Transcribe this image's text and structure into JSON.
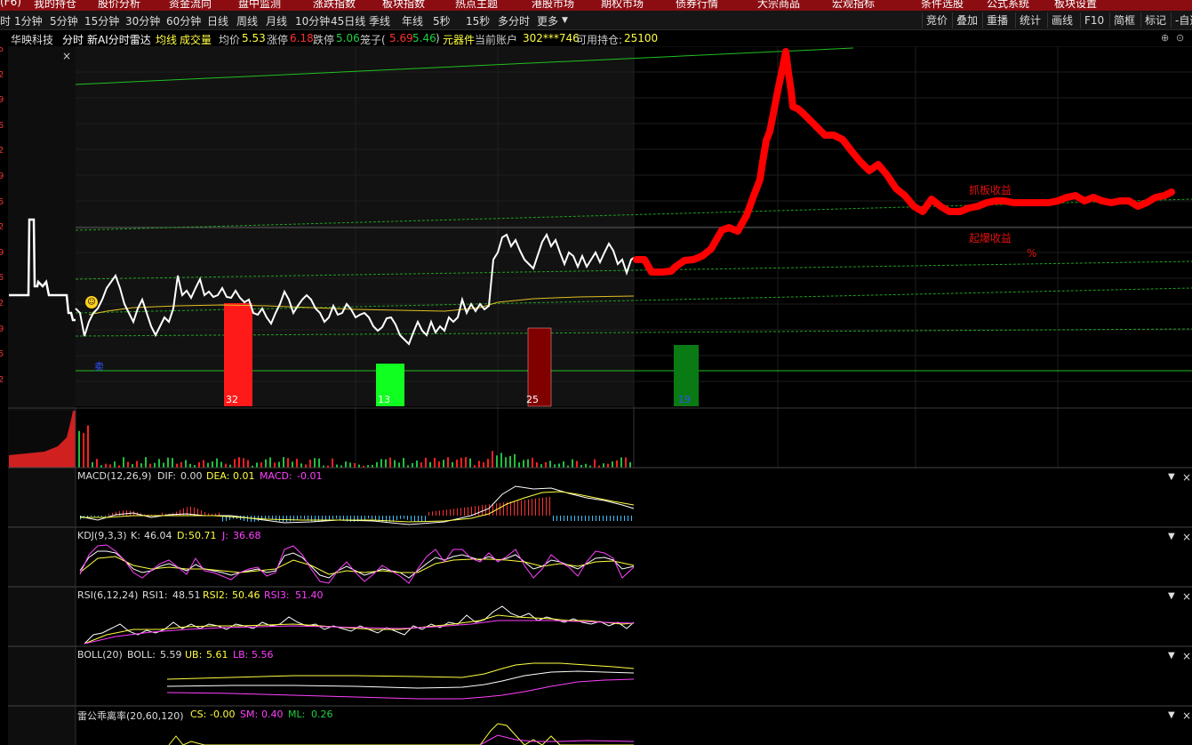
{
  "topbar": {
    "items": [
      "(F6)",
      "我的持仓",
      "股价分析",
      "资金流向",
      "盘中监测",
      "涨跌指数",
      "板块指数",
      "热点主题",
      "港股市场",
      "期权市场",
      "债券行情",
      "大宗商品",
      "宏观指标",
      "条件选股",
      "公式系统",
      "板块设置"
    ]
  },
  "period_tabs": [
    "时",
    "1分钟",
    "5分钟",
    "15分钟",
    "30分钟",
    "60分钟",
    "日线",
    "周线",
    "月线",
    "10分钟",
    "45日线",
    "季线",
    "年线",
    "5秒",
    "15秒",
    "多分时",
    "更多"
  ],
  "right_tools": [
    "竞价",
    "叠加",
    "重播",
    "统计",
    "画线",
    "F10",
    "简框",
    "标记",
    "-自选"
  ],
  "info": {
    "stock_name": "华映科技",
    "mode": "分时",
    "indicator": "新AI分时雷达",
    "avg_line": "均线",
    "volume": "成交量",
    "avg_price_label": "均价",
    "avg_price": "5.53",
    "limit_up_label": "涨停",
    "limit_up": "6.18",
    "limit_down_label": "跌停",
    "limit_down": "5.06",
    "cage_label": "笼子(",
    "cage_low": "5.69",
    "cage_high": "5.46",
    "cage_close": ")",
    "widget": "元器件",
    "account_label": "当前账户",
    "account": "302***746",
    "holding_label": "可用持仓:",
    "holding": "25100"
  },
  "left_axis_ticks": [
    "5",
    "2",
    "9",
    "5",
    "2",
    "9",
    "5",
    "2",
    "9",
    "5",
    "2",
    "9",
    "5",
    "2"
  ],
  "main_chart": {
    "icon_label": "卖",
    "bar_labels": [
      "32",
      "13",
      "25",
      "19"
    ],
    "annotation_1": "抓板收益",
    "annotation_2": "起爆收益",
    "annotation_3": "%"
  },
  "panels": {
    "macd": {
      "name": "MACD(12,26,9)",
      "dif_label": "DIF:",
      "dif": "0.00",
      "dea_label": "DEA:",
      "dea": "0.01",
      "macd_label": "MACD:",
      "macd": "-0.01"
    },
    "kdj": {
      "name": "KDJ(9,3,3)",
      "k_label": "K:",
      "k": "46.04",
      "d_label": "D:",
      "d": "50.71",
      "j_label": "J:",
      "j": "36.68"
    },
    "rsi": {
      "name": "RSI(6,12,24)",
      "rsi1_label": "RSI1:",
      "rsi1": "48.51",
      "rsi2_label": "RSI2:",
      "rsi2": "50.46",
      "rsi3_label": "RSI3:",
      "rsi3": "51.40"
    },
    "boll": {
      "name": "BOLL(20)",
      "boll_label": "BOLL:",
      "boll": "5.59",
      "ub_label": "UB:",
      "ub": "5.61",
      "lb_label": "LB:",
      "lb": "5.56"
    },
    "lgqll": {
      "name": "雷公乖离率(20,60,120)",
      "cs_label": "CS:",
      "cs": "-0.00",
      "sm_label": "SM:",
      "sm": "0.40",
      "ml_label": "ML:",
      "ml": "0.26"
    }
  },
  "colors": {
    "up": "#ff2020",
    "down": "#20c040",
    "yellow": "#ffff40",
    "magenta": "#ff40ff",
    "white": "#ffffff",
    "accent_red": "#8b0d12"
  }
}
